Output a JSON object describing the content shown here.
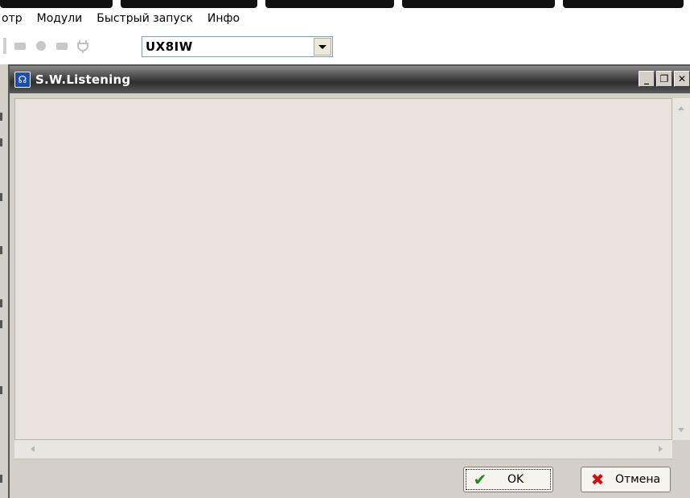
{
  "menu": {
    "items": [
      "отр",
      "Модули",
      "Быстрый запуск",
      "Инфо"
    ]
  },
  "toolbar": {
    "callsign_value": "UX8IW",
    "icons": [
      "toolbar-button-icon",
      "toolbar-button-icon",
      "record-icon",
      "toolbar-button-icon",
      "plug-icon"
    ]
  },
  "window": {
    "title": "S.W.Listening",
    "icon": "app-icon",
    "controls": [
      "minimize-icon",
      "restore-icon",
      "close-icon"
    ],
    "ok_label": "OK",
    "cancel_label": "Отмена"
  },
  "colors": {
    "titlebar": "#3a3a3a",
    "client_bg": "#e9e2dd",
    "ok_icon": "#1b8c1b",
    "cancel_icon": "#d01010"
  }
}
